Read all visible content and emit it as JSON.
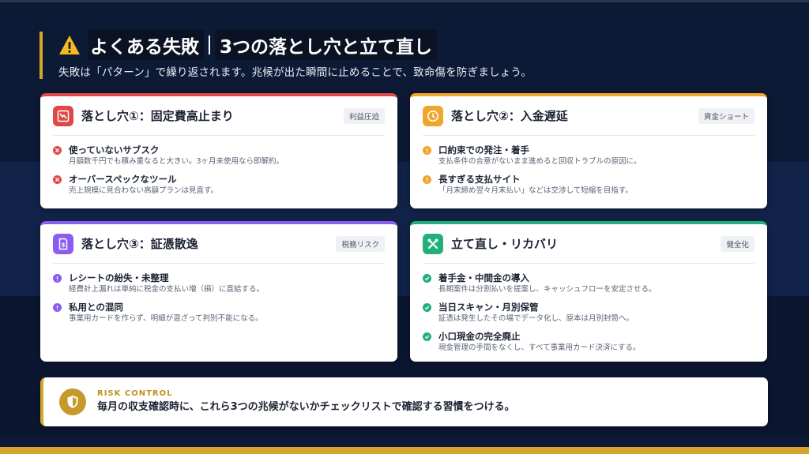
{
  "header": {
    "title_main": "よくある失敗",
    "title_sub": "3つの落とし穴と立て直し",
    "subtitle": "失敗は「パターン」で繰り返されます。兆候が出た瞬間に止めることで、致命傷を防ぎましょう。"
  },
  "colors": {
    "accent_gold": "#d4a72c",
    "red": "#e04848",
    "orange": "#f0a52c",
    "purple": "#8a5cf0",
    "green": "#22b07a"
  },
  "cards": [
    {
      "title": "落とし穴①：固定費高止まり",
      "tag": "利益圧迫",
      "icon": "chart-down-icon",
      "items": [
        {
          "title": "使っていないサブスク",
          "desc": "月額数千円でも積み重なると大きい。3ヶ月未使用なら即解約。"
        },
        {
          "title": "オーバースペックなツール",
          "desc": "売上規模に見合わない高額プランは見直す。"
        }
      ]
    },
    {
      "title": "落とし穴②：入金遅延",
      "tag": "資金ショート",
      "icon": "clock-icon",
      "items": [
        {
          "title": "口約束での発注・着手",
          "desc": "支払条件の合意がないまま進めると回収トラブルの原因に。"
        },
        {
          "title": "長すぎる支払サイト",
          "desc": "「月末締め翌々月末払い」などは交渉して短縮を目指す。"
        }
      ]
    },
    {
      "title": "落とし穴③：証憑散逸",
      "tag": "税務リスク",
      "icon": "receipt-icon",
      "items": [
        {
          "title": "レシートの紛失・未整理",
          "desc": "経費計上漏れは単純に税金の支払い増（損）に直結する。"
        },
        {
          "title": "私用との混同",
          "desc": "事業用カードを作らず、明細が混ざって判別不能になる。"
        }
      ]
    },
    {
      "title": "立て直し・リカバリ",
      "tag": "健全化",
      "icon": "tools-icon",
      "items": [
        {
          "title": "着手金・中間金の導入",
          "desc": "長期案件は分割払いを提案し、キャッシュフローを安定させる。"
        },
        {
          "title": "当日スキャン・月別保管",
          "desc": "証憑は発生したその場でデータ化し、原本は月別封筒へ。"
        },
        {
          "title": "小口現金の完全廃止",
          "desc": "現金管理の手間をなくし、すべて事業用カード決済にする。"
        }
      ]
    }
  ],
  "risk": {
    "label": "RISK CONTROL",
    "text": "毎月の収支確認時に、これら3つの兆候がないかチェックリストで確認する習慣をつける。",
    "icon": "shield-icon"
  }
}
